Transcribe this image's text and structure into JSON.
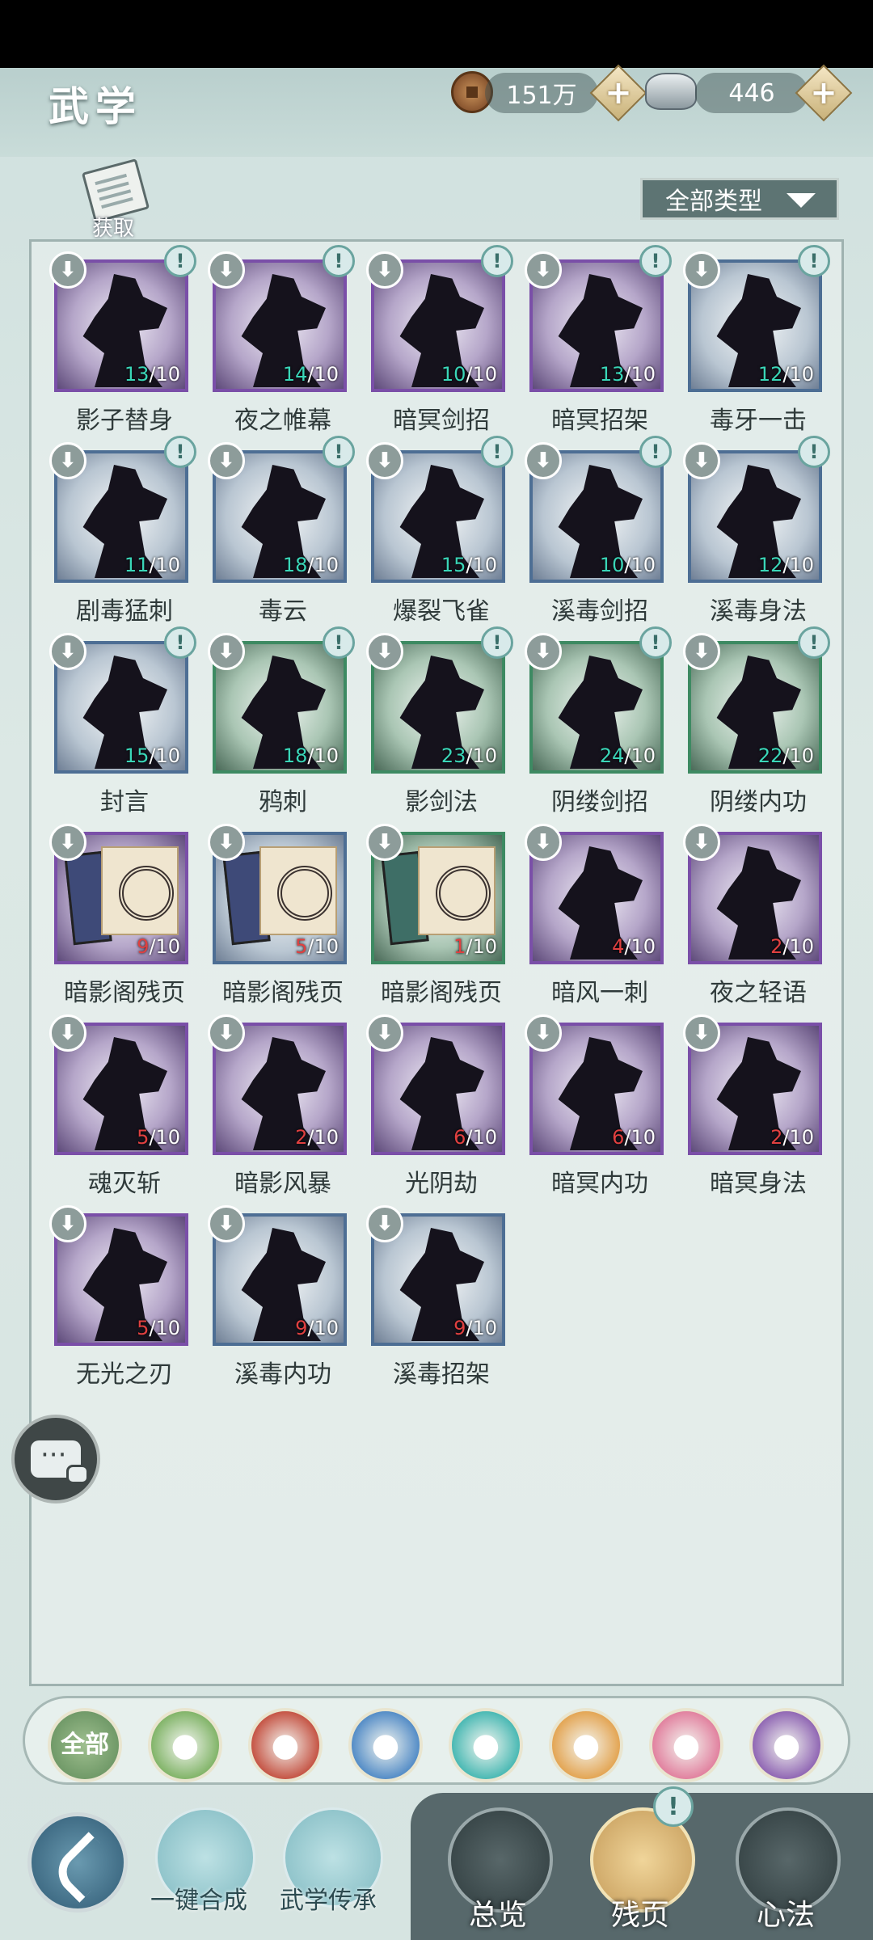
{
  "header": {
    "title": "武学",
    "copper": "151万",
    "silver": "446",
    "plus_label": "+",
    "acquire_label": "获取",
    "filter_label": "全部类型"
  },
  "badges": {
    "download": "⬇",
    "alert": "!"
  },
  "skills": [
    {
      "name": "影子替身",
      "have": "13",
      "need": "10",
      "rarity": "purple",
      "kind": "figure"
    },
    {
      "name": "夜之帷幕",
      "have": "14",
      "need": "10",
      "rarity": "purple",
      "kind": "figure"
    },
    {
      "name": "暗冥剑招",
      "have": "10",
      "need": "10",
      "rarity": "purple",
      "kind": "figure"
    },
    {
      "name": "暗冥招架",
      "have": "13",
      "need": "10",
      "rarity": "purple",
      "kind": "figure"
    },
    {
      "name": "毒牙一击",
      "have": "12",
      "need": "10",
      "rarity": "blue",
      "kind": "figure"
    },
    {
      "name": "剧毒猛刺",
      "have": "11",
      "need": "10",
      "rarity": "blue",
      "kind": "figure"
    },
    {
      "name": "毒云",
      "have": "18",
      "need": "10",
      "rarity": "blue",
      "kind": "figure"
    },
    {
      "name": "爆裂飞雀",
      "have": "15",
      "need": "10",
      "rarity": "blue",
      "kind": "figure"
    },
    {
      "name": "溪毒剑招",
      "have": "10",
      "need": "10",
      "rarity": "blue",
      "kind": "figure"
    },
    {
      "name": "溪毒身法",
      "have": "12",
      "need": "10",
      "rarity": "blue",
      "kind": "figure"
    },
    {
      "name": "封言",
      "have": "15",
      "need": "10",
      "rarity": "blue",
      "kind": "figure"
    },
    {
      "name": "鸦刺",
      "have": "18",
      "need": "10",
      "rarity": "green",
      "kind": "figure"
    },
    {
      "name": "影剑法",
      "have": "23",
      "need": "10",
      "rarity": "green",
      "kind": "figure"
    },
    {
      "name": "阴缕剑招",
      "have": "24",
      "need": "10",
      "rarity": "green",
      "kind": "figure"
    },
    {
      "name": "阴缕内功",
      "have": "22",
      "need": "10",
      "rarity": "green",
      "kind": "figure"
    },
    {
      "name": "暗影阁残页",
      "have": "9",
      "need": "10",
      "rarity": "purple",
      "kind": "scroll"
    },
    {
      "name": "暗影阁残页",
      "have": "5",
      "need": "10",
      "rarity": "blue",
      "kind": "scroll"
    },
    {
      "name": "暗影阁残页",
      "have": "1",
      "need": "10",
      "rarity": "green",
      "kind": "scroll"
    },
    {
      "name": "暗风一刺",
      "have": "4",
      "need": "10",
      "rarity": "purple",
      "kind": "figure"
    },
    {
      "name": "夜之轻语",
      "have": "2",
      "need": "10",
      "rarity": "purple",
      "kind": "figure"
    },
    {
      "name": "魂灭斩",
      "have": "5",
      "need": "10",
      "rarity": "purple",
      "kind": "figure"
    },
    {
      "name": "暗影风暴",
      "have": "2",
      "need": "10",
      "rarity": "purple",
      "kind": "figure"
    },
    {
      "name": "光阴劫",
      "have": "6",
      "need": "10",
      "rarity": "purple",
      "kind": "figure"
    },
    {
      "name": "暗冥内功",
      "have": "6",
      "need": "10",
      "rarity": "purple",
      "kind": "figure"
    },
    {
      "name": "暗冥身法",
      "have": "2",
      "need": "10",
      "rarity": "purple",
      "kind": "figure"
    },
    {
      "name": "无光之刃",
      "have": "5",
      "need": "10",
      "rarity": "purple",
      "kind": "figure"
    },
    {
      "name": "溪毒内功",
      "have": "9",
      "need": "10",
      "rarity": "blue",
      "kind": "figure"
    },
    {
      "name": "溪毒招架",
      "have": "9",
      "need": "10",
      "rarity": "blue",
      "kind": "figure"
    }
  ],
  "elements": {
    "all_label": "全部",
    "icons": [
      "all-icon",
      "grass-icon",
      "fire-icon",
      "water-icon",
      "wind-icon",
      "shield-icon",
      "moon-icon",
      "shadow-icon"
    ],
    "colors": [
      "#5d8a58",
      "#7ab060",
      "#c24a3a",
      "#4a86c4",
      "#3fb5b0",
      "#e2a04a",
      "#e07a9a",
      "#8a5eb0"
    ]
  },
  "bottom": {
    "one_click_label": "一键合成",
    "inherit_label": "武学传承",
    "nav": [
      {
        "label": "总览",
        "active": false
      },
      {
        "label": "残页",
        "active": true
      },
      {
        "label": "心法",
        "active": false
      }
    ]
  }
}
